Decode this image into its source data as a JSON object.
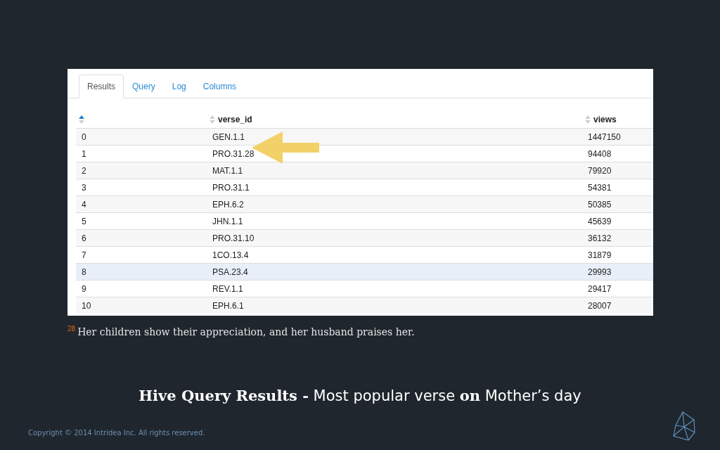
{
  "tabs": [
    {
      "label": "Results",
      "selected": true
    },
    {
      "label": "Query",
      "selected": false
    },
    {
      "label": "Log",
      "selected": false
    },
    {
      "label": "Columns",
      "selected": false
    }
  ],
  "table": {
    "columns": [
      {
        "sorted": true
      },
      {
        "label": "verse_id",
        "sorted": false
      },
      {
        "label": "views",
        "sorted": false
      }
    ],
    "rows": [
      {
        "cells": [
          "0",
          "GEN.1.1",
          "1447150"
        ],
        "selected": false
      },
      {
        "cells": [
          "1",
          "PRO.31.28",
          "94408"
        ],
        "selected": false
      },
      {
        "cells": [
          "2",
          "MAT.1.1",
          "79920"
        ],
        "selected": false
      },
      {
        "cells": [
          "3",
          "PRO.31.1",
          "54381"
        ],
        "selected": false
      },
      {
        "cells": [
          "4",
          "EPH.6.2",
          "50385"
        ],
        "selected": false
      },
      {
        "cells": [
          "5",
          "JHN.1.1",
          "45639"
        ],
        "selected": false
      },
      {
        "cells": [
          "6",
          "PRO.31.10",
          "36132"
        ],
        "selected": false
      },
      {
        "cells": [
          "7",
          "1CO.13.4",
          "31879"
        ],
        "selected": false
      },
      {
        "cells": [
          "8",
          "PSA.23.4",
          "29993"
        ],
        "selected": true
      },
      {
        "cells": [
          "9",
          "REV.1.1",
          "29417"
        ],
        "selected": false
      },
      {
        "cells": [
          "10",
          "EPH.6.1",
          "28007"
        ],
        "selected": false
      }
    ]
  },
  "verse": "$^{28}$Her children show their appreciation, and her husband praises her.",
  "caption": "**Hive Query Results -** Most popular verse **on** Mother’s day",
  "footer": {
    "copyright": "Copyright © 2014 Intridea Inc. All rights reserved."
  }
}
